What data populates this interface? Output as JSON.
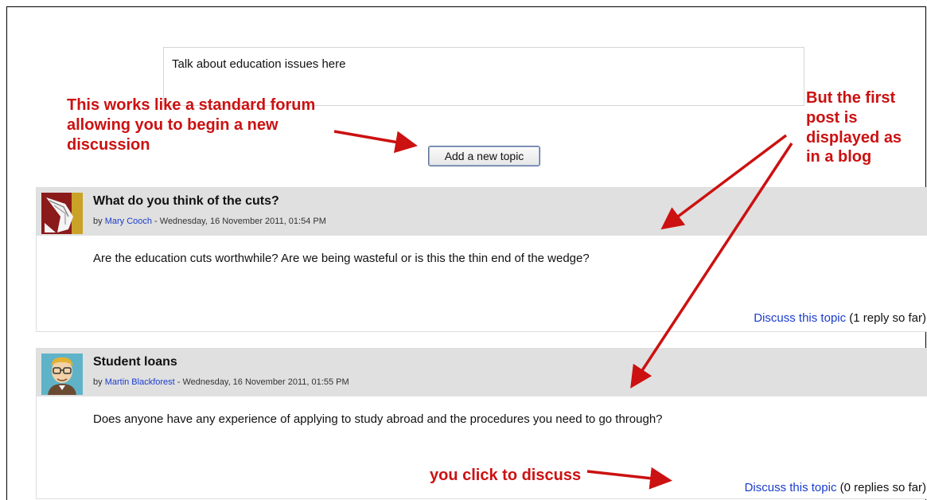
{
  "forum": {
    "intro_text": "Talk about education issues here",
    "add_topic_label": "Add a new topic"
  },
  "posts": [
    {
      "subject": "What do you think of the cuts?",
      "by_prefix": "by",
      "author": "Mary Cooch",
      "date": " - Wednesday, 16 November 2011, 01:54 PM",
      "body": "Are the education cuts worthwhile? Are we being wasteful or is this the thin end of the wedge?",
      "discuss_link": "Discuss this topic",
      "reply_count": "(1 reply so far)"
    },
    {
      "subject": "Student loans",
      "by_prefix": "by",
      "author": "Martin Blackforest",
      "date": " - Wednesday, 16 November 2011, 01:55 PM",
      "body": "Does anyone have any experience of applying to study abroad and the procedures you need to go through?",
      "discuss_link": "Discuss this topic",
      "reply_count": "(0 replies so far)"
    }
  ],
  "annotations": {
    "standard_forum_line1": "This works like a standard forum",
    "standard_forum_line2": "allowing you to begin a new",
    "standard_forum_line3": "discussion",
    "blog_line1": "But the first",
    "blog_line2": "post is",
    "blog_line3": "displayed as",
    "blog_line4": "in  a blog",
    "click_to_discuss": "you click to discuss"
  },
  "colors": {
    "annotation_red": "#cc1111",
    "link_blue": "#1a3ccc",
    "post_header_bg": "#e0e0e0"
  }
}
